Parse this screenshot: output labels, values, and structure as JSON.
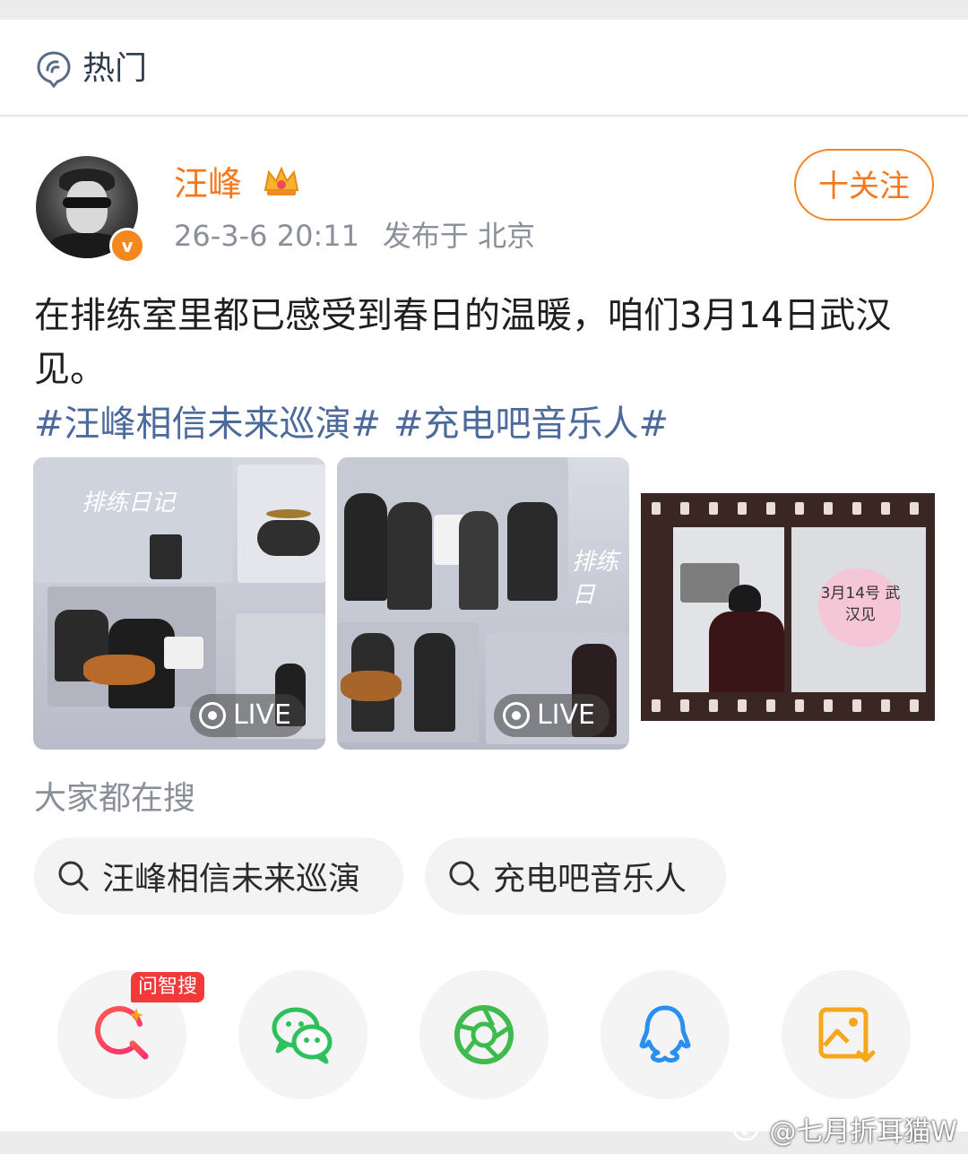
{
  "header": {
    "section_label": "热门"
  },
  "post": {
    "author": "汪峰",
    "verified_badge": "v",
    "timestamp": "26-3-6 20:11",
    "location": "发布于 北京",
    "follow_label": "十关注",
    "text": "在排练室里都已感受到春日的温暖，咱们3月14日武汉见。",
    "hashtags": [
      "#汪峰相信未来巡演#",
      "#充电吧音乐人#"
    ],
    "images": [
      {
        "overlay_text": "排练日记",
        "live_label": "LIVE"
      },
      {
        "overlay_text": "排练日",
        "live_label": "LIVE"
      },
      {
        "note_text": "3月14号 武汉见"
      }
    ]
  },
  "search": {
    "title": "大家都在搜",
    "chips": [
      "汪峰相信未来巡演",
      "充电吧音乐人"
    ]
  },
  "share": {
    "ai_tag": "问智搜",
    "icons": [
      "ai-search-icon",
      "wechat-icon",
      "moments-icon",
      "qq-icon",
      "save-image-icon"
    ]
  },
  "watermark": "@七月折耳猫W",
  "colors": {
    "accent": "#f5781f",
    "link": "#4c6a9c",
    "muted": "#8a8f99"
  }
}
